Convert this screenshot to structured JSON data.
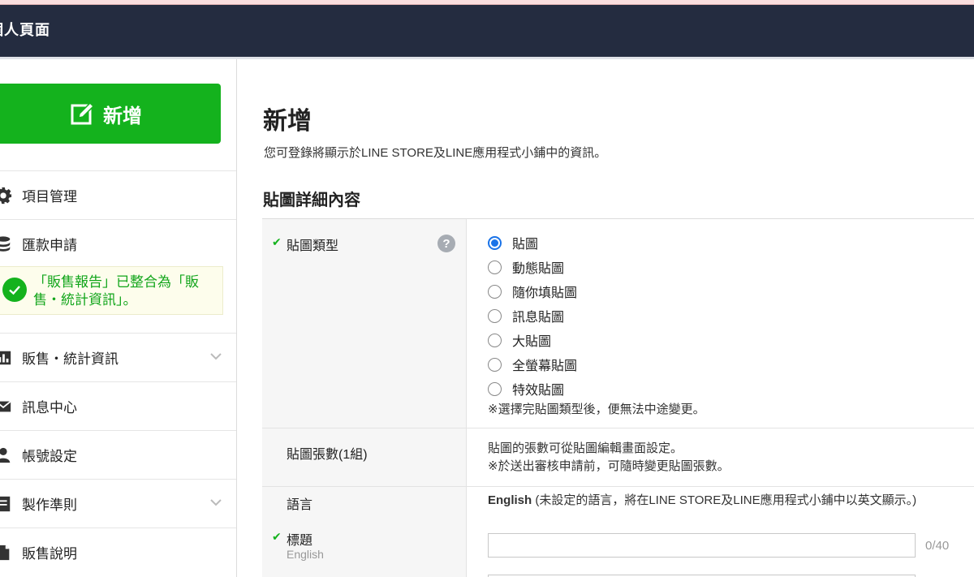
{
  "header": {
    "title": "個人頁面"
  },
  "sidebar": {
    "new_button": {
      "label": "新增",
      "icon": "edit-icon"
    },
    "items": [
      {
        "label": "項目管理",
        "icon": "gear-icon"
      },
      {
        "label": "匯款申請",
        "icon": "coins-icon"
      },
      {
        "label": "販售・統計資訊",
        "icon": "bar-chart-icon"
      },
      {
        "label": "訊息中心",
        "icon": "envelope-icon"
      },
      {
        "label": "帳號設定",
        "icon": "user-icon"
      },
      {
        "label": "製作準則",
        "icon": "book-icon"
      },
      {
        "label": "販售說明",
        "icon": "document-icon"
      }
    ],
    "notice": {
      "text": "「販售報告」已整合為「販售・統計資訊」。",
      "icon": "check-circle-icon"
    }
  },
  "main": {
    "title": "新增",
    "description": "您可登錄將顯示於LINE STORE及LINE應用程式小鋪中的資訊。",
    "section_title": "貼圖詳細內容",
    "sticker_type": {
      "label": "貼圖類型",
      "options": [
        "貼圖",
        "動態貼圖",
        "隨你填貼圖",
        "訊息貼圖",
        "大貼圖",
        "全螢幕貼圖",
        "特效貼圖"
      ],
      "selected": "貼圖",
      "note": "※選擇完貼圖類型後，便無法中途變更。"
    },
    "sticker_count": {
      "label": "貼圖張數(1組)",
      "line1": "貼圖的張數可從貼圖編輯畫面設定。",
      "line2": "※於送出審核申請前，可隨時變更貼圖張數。"
    },
    "language": {
      "label": "語言",
      "value_strong": "English",
      "value_note": "(未設定的語言，將在LINE STORE及LINE應用程式小鋪中以英文顯示。)"
    },
    "title_field": {
      "label": "標題",
      "sublabel": "English",
      "value": "",
      "counter": "0/40"
    }
  },
  "colors": {
    "header_bg": "#242c40",
    "accent_green": "#14b21d",
    "radio_blue": "#1a73e8"
  }
}
